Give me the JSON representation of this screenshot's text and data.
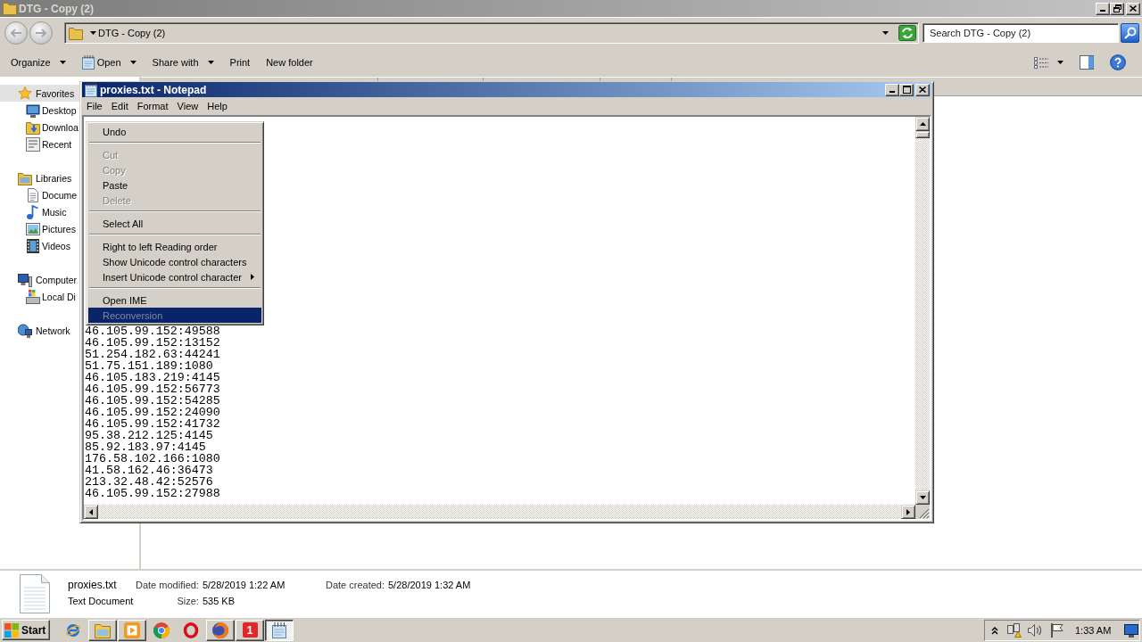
{
  "explorer": {
    "title": "DTG - Copy (2)",
    "address": "DTG - Copy (2)",
    "search": {
      "placeholder": "Search DTG - Copy (2)"
    },
    "toolbar": [
      {
        "label": "Organize",
        "dropdown": true,
        "icon": false
      },
      {
        "label": "Open",
        "dropdown": true,
        "icon": true
      },
      {
        "label": "Share with",
        "dropdown": true,
        "icon": false
      },
      {
        "label": "Print",
        "dropdown": false,
        "icon": false
      },
      {
        "label": "New folder",
        "dropdown": false,
        "icon": false
      }
    ],
    "nav": [
      {
        "label": "Favorites",
        "kind": "star",
        "selected": true,
        "children": [
          {
            "label": "Desktop",
            "kind": "desktop",
            "selected": false
          },
          {
            "label": "Downloa",
            "kind": "downloads",
            "selected": false
          },
          {
            "label": "Recent",
            "kind": "recent",
            "selected": false
          }
        ]
      },
      {
        "label": "Libraries",
        "kind": "library",
        "selected": false,
        "children": [
          {
            "label": "Docume",
            "kind": "document",
            "selected": false
          },
          {
            "label": "Music",
            "kind": "music",
            "selected": false
          },
          {
            "label": "Pictures",
            "kind": "pictures",
            "selected": false
          },
          {
            "label": "Videos",
            "kind": "videos",
            "selected": false
          }
        ]
      },
      {
        "label": "Computer",
        "kind": "computer",
        "selected": false,
        "children": [
          {
            "label": "Local Di",
            "kind": "drive",
            "selected": false
          }
        ]
      },
      {
        "label": "Network",
        "kind": "network",
        "selected": false
      }
    ],
    "details": {
      "name": "proxies.txt",
      "type": "Text Document",
      "fields": [
        {
          "label": "Date modified:",
          "value": "5/28/2019 1:22 AM"
        },
        {
          "label": "Date created:",
          "value": "5/28/2019 1:32 AM"
        },
        {
          "label": "Size:",
          "value": "535 KB"
        }
      ]
    }
  },
  "notepad": {
    "title": "proxies.txt - Notepad",
    "menu": [
      "File",
      "Edit",
      "Format",
      "View",
      "Help"
    ],
    "lines": [
      "46.105.99.152:49588",
      "46.105.99.152:13152",
      "51.254.182.63:44241",
      "51.75.151.189:1080",
      "46.105.183.219:4145",
      "46.105.99.152:56773",
      "46.105.99.152:54285",
      "46.105.99.152:24090",
      "46.105.99.152:41732",
      "95.38.212.125:4145",
      "85.92.183.97:4145",
      "176.58.102.166:1080",
      "41.58.162.46:36473",
      "213.32.48.42:52576",
      "46.105.99.152:27988"
    ]
  },
  "context_menu": [
    {
      "kind": "item",
      "label": "Undo",
      "disabled": false,
      "selected": false,
      "submenu": false
    },
    {
      "kind": "separator"
    },
    {
      "kind": "item",
      "label": "Cut",
      "disabled": true,
      "selected": false,
      "submenu": false
    },
    {
      "kind": "item",
      "label": "Copy",
      "disabled": true,
      "selected": false,
      "submenu": false
    },
    {
      "kind": "item",
      "label": "Paste",
      "disabled": false,
      "selected": false,
      "submenu": false
    },
    {
      "kind": "item",
      "label": "Delete",
      "disabled": true,
      "selected": false,
      "submenu": false
    },
    {
      "kind": "separator"
    },
    {
      "kind": "item",
      "label": "Select All",
      "disabled": false,
      "selected": false,
      "submenu": false
    },
    {
      "kind": "separator"
    },
    {
      "kind": "item",
      "label": "Right to left Reading order",
      "disabled": false,
      "selected": false,
      "submenu": false
    },
    {
      "kind": "item",
      "label": "Show Unicode control characters",
      "disabled": false,
      "selected": false,
      "submenu": false
    },
    {
      "kind": "item",
      "label": "Insert Unicode control character",
      "disabled": false,
      "selected": false,
      "submenu": true
    },
    {
      "kind": "separator"
    },
    {
      "kind": "item",
      "label": "Open IME",
      "disabled": false,
      "selected": false,
      "submenu": false
    },
    {
      "kind": "item",
      "label": "Reconversion",
      "disabled": true,
      "selected": true,
      "submenu": false
    }
  ],
  "taskbar": {
    "start": "Start",
    "apps": [
      {
        "kind": "e-logo",
        "open": false,
        "selected": false
      },
      {
        "kind": "folder",
        "open": true,
        "selected": false
      },
      {
        "kind": "play",
        "open": true,
        "selected": false
      },
      {
        "kind": "ring",
        "open": false,
        "selected": false
      },
      {
        "kind": "red-ring",
        "open": false,
        "selected": false
      },
      {
        "kind": "globe",
        "open": true,
        "selected": false
      },
      {
        "kind": "number",
        "label": "1",
        "open": true,
        "selected": false
      },
      {
        "kind": "notepad",
        "open": true,
        "selected": true
      }
    ],
    "clock": "1:33 AM"
  }
}
